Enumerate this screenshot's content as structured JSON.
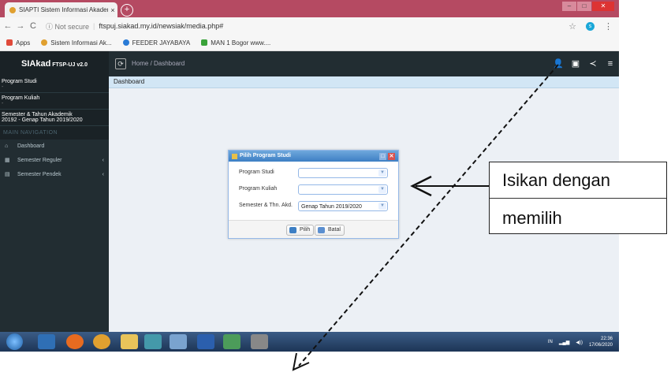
{
  "browser": {
    "tab_title": "SIAPTI Sistem Informasi Akadem",
    "tab_close": "×",
    "new_tab": "+",
    "back": "←",
    "forward": "→",
    "reload": "C",
    "security": "ⓘ Not secure",
    "url": "ftspuj.siakad.my.id/newsiak/media.php#",
    "profile_initial": "s"
  },
  "bookmarks": [
    {
      "label": "Apps",
      "color": "#e04a3a"
    },
    {
      "label": "Sistem Informasi Ak...",
      "color": "#e0a030"
    },
    {
      "label": "FEEDER JAYABAYA",
      "color": "#2a7bd6"
    },
    {
      "label": "MAN 1 Bogor www....",
      "color": "#3aa33a"
    }
  ],
  "app": {
    "logo_main": "SIAkad",
    "logo_sub": " FTSP-UJ v2.0",
    "breadcrumb": "Home / Dashboard"
  },
  "sidebar": {
    "program_studi_label": "Program Studi",
    "program_studi_value": "-",
    "program_kuliah_label": "Program Kuliah",
    "program_kuliah_value": "-",
    "semester_label": "Semester & Tahun Akademik",
    "semester_value": "20192 - Genap Tahun 2019/2020",
    "nav_header": "MAIN NAVIGATION",
    "items": [
      {
        "label": "Dashboard",
        "icon": "home-icon",
        "glyph": "⌂",
        "caret": ""
      },
      {
        "label": "Semester Reguler",
        "icon": "calendar-icon",
        "glyph": "▦",
        "caret": "‹"
      },
      {
        "label": "Semester Pendek",
        "icon": "document-icon",
        "glyph": "▤",
        "caret": "‹"
      }
    ]
  },
  "content": {
    "title": "Dashboard"
  },
  "dialog": {
    "title": "Pilih Program Studi",
    "fields": [
      {
        "label": "Program Studi",
        "value": ""
      },
      {
        "label": "Program Kuliah",
        "value": ""
      },
      {
        "label": "Semester & Thn. Akd.",
        "value": "Genap Tahun 2019/2020"
      }
    ],
    "ok_label": "Pilih",
    "cancel_label": "Batal"
  },
  "taskbar": {
    "lang": "IN",
    "time": "22:36",
    "date": "17/06/2020"
  },
  "annotation": {
    "line1": "Isikan dengan",
    "line2": "memilih"
  },
  "colors": {
    "header_bg": "#222d32",
    "sidebar_bg": "#222d32",
    "dialog_header": "#3d7fc4",
    "tab_bar": "#b54a62"
  }
}
